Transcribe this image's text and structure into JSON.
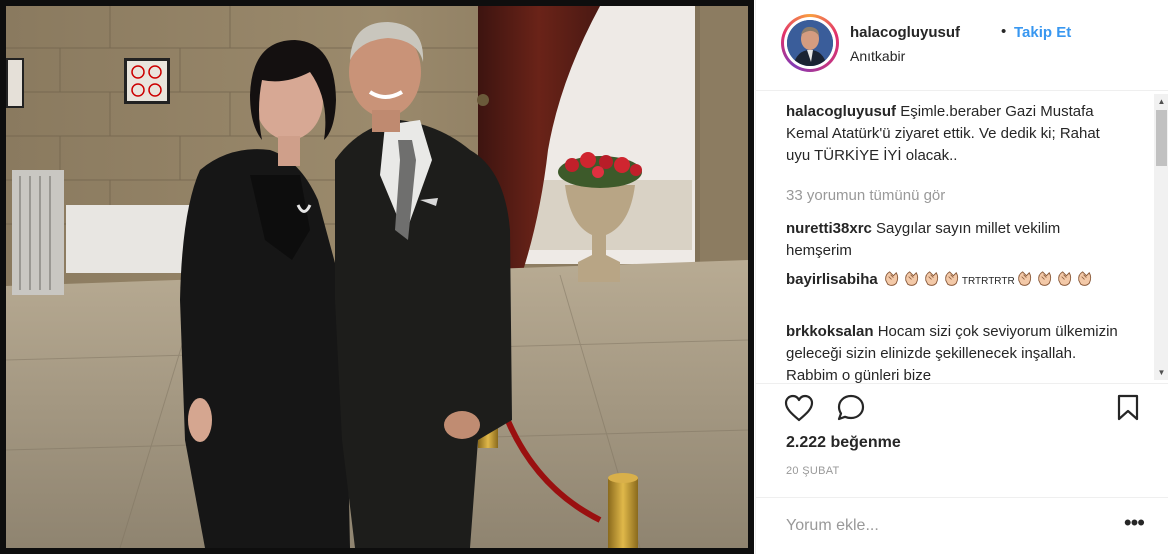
{
  "post": {
    "username": "halacogluyusuf",
    "separator": "•",
    "follow_label": "Takip Et",
    "location": "Anıtkabir",
    "caption_user": "halacogluyusuf",
    "caption_text": "Eşimle.beraber Gazi Mustafa Kemal Atatürk'ü ziyaret ettik. Ve dedik ki; Rahat uyu TÜRKİYE İYİ olacak..",
    "view_all_comments": "33 yorumun tümünü gör",
    "likes": "2.222 beğenme",
    "date": "20 ŞUBAT",
    "comment_placeholder": "Yorum ekle...",
    "more_options": "•••"
  },
  "comments": [
    {
      "user": "nuretti38xrc",
      "text": "Saygılar sayın millet vekilim hemşerim"
    },
    {
      "user": "bayirlisabiha",
      "text_inline": "TRTRTRTR",
      "icons": [
        "clapping-hands-icon"
      ]
    },
    {
      "user": "brkkoksalan",
      "text": "Hocam sizi çok seviyorum ülkemizin geleceği sizin elinizde şekillenecek inşallah. Rabbim o günleri bize"
    }
  ],
  "colors": {
    "accent": "#3897f0",
    "text": "#262626",
    "muted": "#999999",
    "border": "#efefef"
  }
}
